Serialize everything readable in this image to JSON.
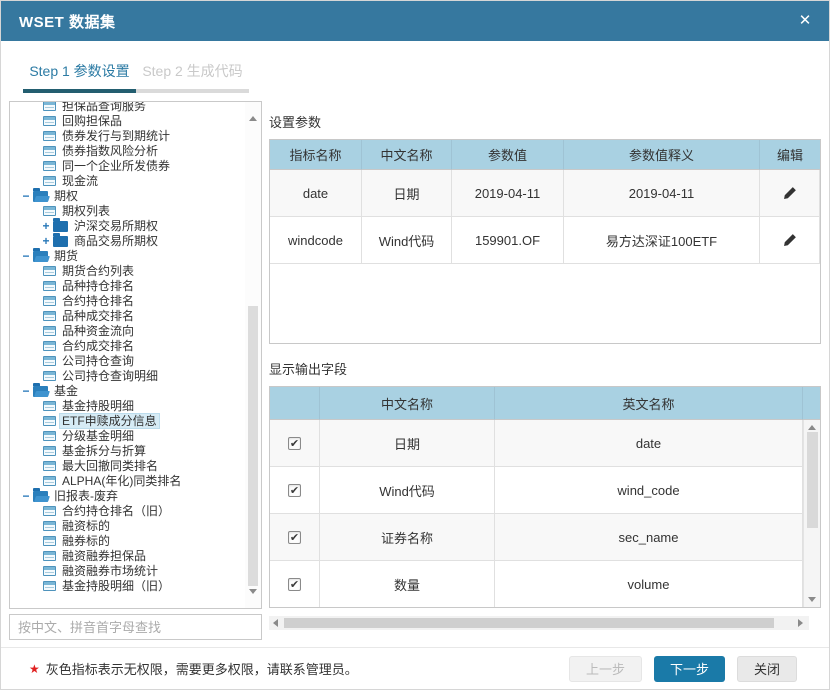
{
  "window": {
    "title": "WSET 数据集",
    "close_glyph": "✕"
  },
  "tabs": [
    {
      "label": "Step 1 参数设置",
      "active": true
    },
    {
      "label": "Step 2 生成代码",
      "active": false
    }
  ],
  "tree": {
    "toggle_open": "−",
    "toggle_closed": "+",
    "search_placeholder": "按中文、拼音首字母查找",
    "items": [
      {
        "label": "担保品查询服务",
        "kind": "leaf",
        "level": 2,
        "partially_visible": true
      },
      {
        "label": "回购担保品",
        "kind": "leaf",
        "level": 2
      },
      {
        "label": "债券发行与到期统计",
        "kind": "leaf",
        "level": 2
      },
      {
        "label": "债券指数风险分析",
        "kind": "leaf",
        "level": 2
      },
      {
        "label": "同一个企业所发债券",
        "kind": "leaf",
        "level": 2
      },
      {
        "label": "现金流",
        "kind": "leaf",
        "level": 2
      },
      {
        "label": "期权",
        "kind": "folder-open",
        "level": 1
      },
      {
        "label": "期权列表",
        "kind": "leaf",
        "level": 2
      },
      {
        "label": "沪深交易所期权",
        "kind": "folder-closed",
        "level": 2
      },
      {
        "label": "商品交易所期权",
        "kind": "folder-closed",
        "level": 2
      },
      {
        "label": "期货",
        "kind": "folder-open",
        "level": 1
      },
      {
        "label": "期货合约列表",
        "kind": "leaf",
        "level": 2
      },
      {
        "label": "品种持仓排名",
        "kind": "leaf",
        "level": 2
      },
      {
        "label": "合约持仓排名",
        "kind": "leaf",
        "level": 2
      },
      {
        "label": "品种成交排名",
        "kind": "leaf",
        "level": 2
      },
      {
        "label": "品种资金流向",
        "kind": "leaf",
        "level": 2
      },
      {
        "label": "合约成交排名",
        "kind": "leaf",
        "level": 2
      },
      {
        "label": "公司持仓查询",
        "kind": "leaf",
        "level": 2
      },
      {
        "label": "公司持仓查询明细",
        "kind": "leaf",
        "level": 2
      },
      {
        "label": "基金",
        "kind": "folder-open",
        "level": 1
      },
      {
        "label": "基金持股明细",
        "kind": "leaf",
        "level": 2
      },
      {
        "label": "ETF申赎成分信息",
        "kind": "leaf",
        "level": 2,
        "selected": true
      },
      {
        "label": "分级基金明细",
        "kind": "leaf",
        "level": 2
      },
      {
        "label": "基金拆分与折算",
        "kind": "leaf",
        "level": 2
      },
      {
        "label": "最大回撤同类排名",
        "kind": "leaf",
        "level": 2
      },
      {
        "label": "ALPHA(年化)同类排名",
        "kind": "leaf",
        "level": 2
      },
      {
        "label": "旧报表-废弃",
        "kind": "folder-open",
        "level": 1
      },
      {
        "label": "合约持仓排名（旧）",
        "kind": "leaf",
        "level": 2
      },
      {
        "label": "融资标的",
        "kind": "leaf",
        "level": 2
      },
      {
        "label": "融券标的",
        "kind": "leaf",
        "level": 2
      },
      {
        "label": "融资融券担保品",
        "kind": "leaf",
        "level": 2
      },
      {
        "label": "融资融券市场统计",
        "kind": "leaf",
        "level": 2
      },
      {
        "label": "基金持股明细（旧）",
        "kind": "leaf",
        "level": 2
      }
    ]
  },
  "params": {
    "title": "设置参数",
    "columns": [
      "指标名称",
      "中文名称",
      "参数值",
      "参数值释义",
      "编辑"
    ],
    "rows": [
      {
        "name": "date",
        "cn": "日期",
        "value": "2019-04-11",
        "meaning": "2019-04-11"
      },
      {
        "name": "windcode",
        "cn": "Wind代码",
        "value": "159901.OF",
        "meaning": "易方达深证100ETF"
      }
    ]
  },
  "fields": {
    "title": "显示输出字段",
    "columns": [
      "",
      "中文名称",
      "英文名称"
    ],
    "check_glyph": "✔",
    "rows": [
      {
        "checked": true,
        "cn": "日期",
        "en": "date"
      },
      {
        "checked": true,
        "cn": "Wind代码",
        "en": "wind_code"
      },
      {
        "checked": true,
        "cn": "证券名称",
        "en": "sec_name"
      },
      {
        "checked": true,
        "cn": "数量",
        "en": "volume"
      }
    ]
  },
  "footer": {
    "note_star": "★",
    "note": "灰色指标表示无权限，需要更多权限，请联系管理员。",
    "buttons": [
      {
        "label": "上一步",
        "name": "prev-step-button",
        "state": "disabled"
      },
      {
        "label": "下一步",
        "name": "next-step-button",
        "state": "primary"
      },
      {
        "label": "关闭",
        "name": "close-button",
        "state": "default"
      }
    ]
  },
  "colors": {
    "titlebar": "#36789F",
    "table_header_bg": "#A9D1E2",
    "primary_button": "#1A7AA8",
    "active_tab_underline": "#235E70",
    "selected_tree_bg": "#D6EBF5",
    "note_star": "#E02020"
  }
}
